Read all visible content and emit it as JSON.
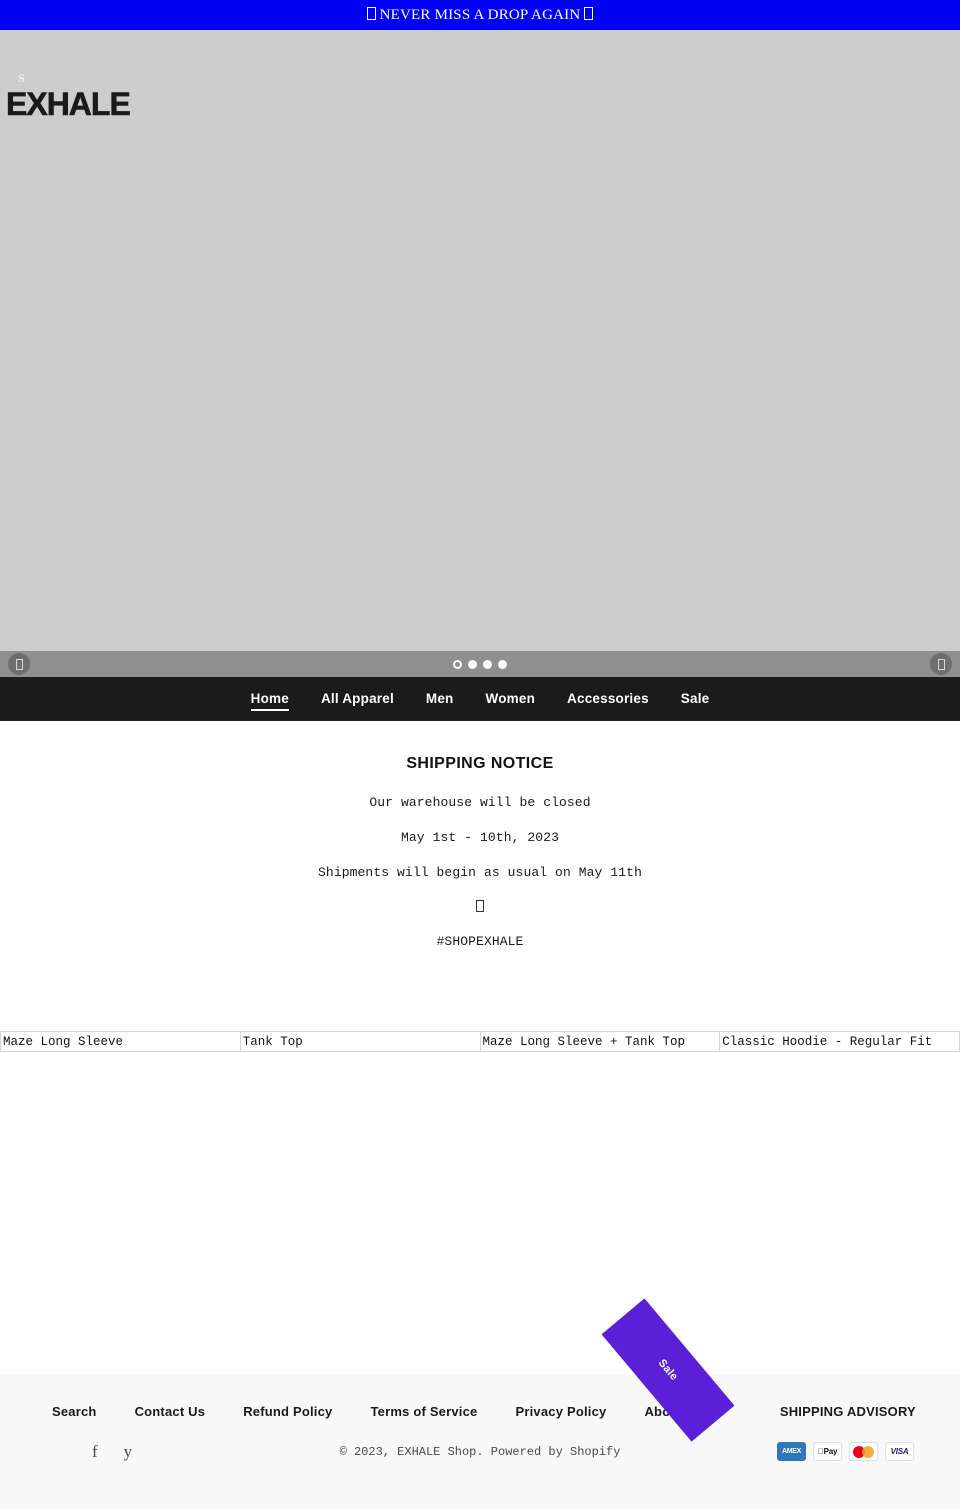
{
  "announcement": {
    "text": "NEVER MISS A DROP AGAIN"
  },
  "brand": {
    "sub": "S",
    "name": "EXHALE"
  },
  "carousel": {
    "prev_label": "Previous slide",
    "next_label": "Next slide",
    "slide_count": 4,
    "current_slide": 1
  },
  "nav": {
    "items": [
      {
        "label": "Home",
        "active": true
      },
      {
        "label": "All Apparel",
        "active": false
      },
      {
        "label": "Men",
        "active": false
      },
      {
        "label": "Women",
        "active": false
      },
      {
        "label": "Accessories",
        "active": false
      },
      {
        "label": "Sale",
        "active": false
      }
    ]
  },
  "notice": {
    "heading": "SHIPPING NOTICE",
    "line1": "Our warehouse will be closed",
    "line2": "May 1st - 10th, 2023",
    "line3": "Shipments will begin as usual on May 11th",
    "hashtag": "#SHOPEXHALE"
  },
  "products": [
    {
      "title": "Maze Long Sleeve"
    },
    {
      "title": "Tank Top"
    },
    {
      "title": "Maze Long Sleeve + Tank Top"
    },
    {
      "title": "Classic Hoodie - Regular Fit"
    }
  ],
  "sale_badge": {
    "label": "Sale",
    "color": "#5a1fd6"
  },
  "footer": {
    "links": [
      {
        "label": "Search"
      },
      {
        "label": "Contact Us"
      },
      {
        "label": "Refund Policy"
      },
      {
        "label": "Terms of Service"
      },
      {
        "label": "Privacy Policy"
      },
      {
        "label": "About Us"
      },
      {
        "label": ""
      },
      {
        "label": "SHIPPING ADVISORY"
      }
    ],
    "socials": [
      {
        "icon": "facebook-icon",
        "glyph": "f"
      },
      {
        "icon": "twitter-icon",
        "glyph": "y"
      }
    ],
    "copyright": "© 2023, EXHALE Shop. Powered by Shopify",
    "payments": [
      {
        "name": "amex",
        "label": "AMEX"
      },
      {
        "name": "apple-pay",
        "label": "Pay"
      },
      {
        "name": "mastercard",
        "label": ""
      },
      {
        "name": "visa",
        "label": "VISA"
      }
    ]
  },
  "colors": {
    "announcement_bg": "#0000f5",
    "nav_bg": "#1b1b1b",
    "hero_bg": "#cdcdcd",
    "footer_bg": "#f8f8f8",
    "sale": "#5a1fd6"
  }
}
